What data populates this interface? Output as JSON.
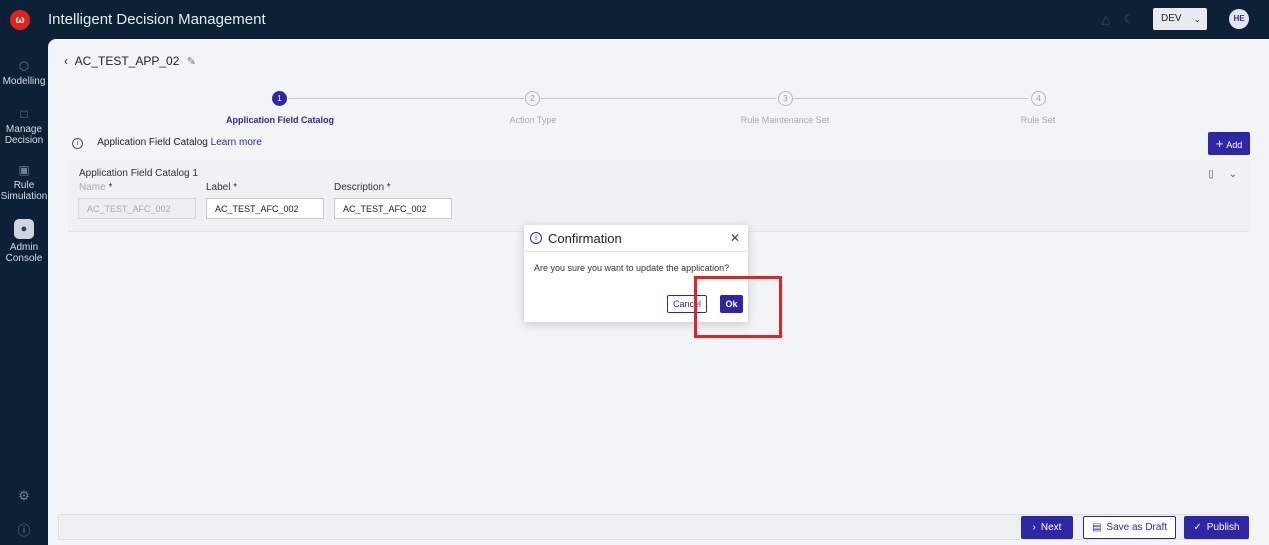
{
  "app": {
    "logo": "ω",
    "title": "Intelligent Decision Management",
    "env": "DEV",
    "avatar": "HE"
  },
  "sidebar": {
    "items": [
      {
        "label_1": "Modelling",
        "label_2": "",
        "icon": "cube-icon"
      },
      {
        "label_1": "Manage",
        "label_2": "Decision",
        "icon": "document-icon"
      },
      {
        "label_1": "Rule",
        "label_2": "Simulation",
        "icon": "briefcase-icon"
      },
      {
        "label_1": "Admin",
        "label_2": "Console",
        "icon": "admin-icon"
      }
    ]
  },
  "page": {
    "title": "AC_TEST_APP_02"
  },
  "stepper": {
    "steps": [
      {
        "num": "1",
        "label": "Application Field Catalog"
      },
      {
        "num": "2",
        "label": "Action Type"
      },
      {
        "num": "3",
        "label": "Rule Maintenance Set"
      },
      {
        "num": "4",
        "label": "Rule Set"
      }
    ]
  },
  "catalog": {
    "heading": "Application Field Catalog",
    "learn_more": "Learn more",
    "add_label": "Add",
    "card_title": "Application Field Catalog 1",
    "fields": [
      {
        "label": "Name",
        "value": "AC_TEST_AFC_002"
      },
      {
        "label": "Label",
        "value": "AC_TEST_AFC_002"
      },
      {
        "label": "Description",
        "value": "AC_TEST_AFC_002"
      }
    ]
  },
  "footer": {
    "next": "Next",
    "save_draft": "Save as Draft",
    "publish": "Publish"
  },
  "modal": {
    "title": "Confirmation",
    "message": "Are you sure you want to update the application?",
    "cancel": "Cancel",
    "ok": "Ok"
  },
  "colors": {
    "primary": "#2d27a6",
    "dark": "#0c2136",
    "highlight": "#e52222"
  }
}
